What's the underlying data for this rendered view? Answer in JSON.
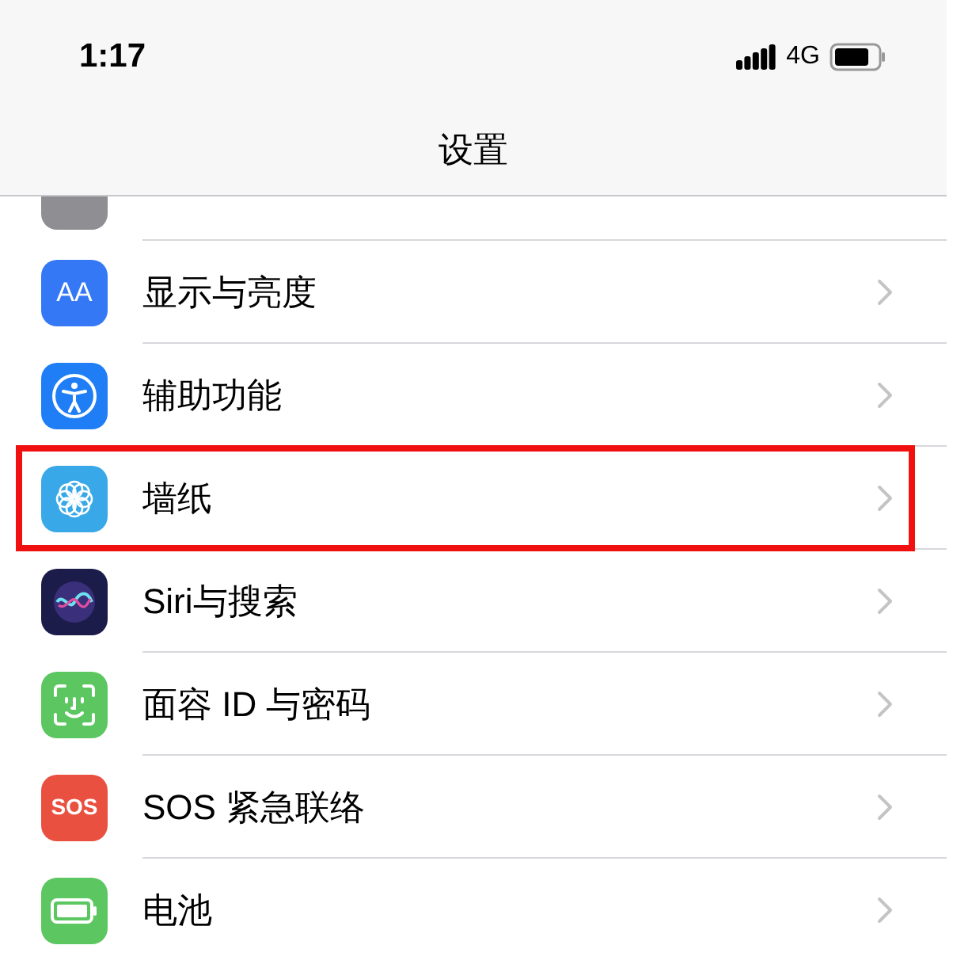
{
  "status_bar": {
    "time": "1:17",
    "network": "4G"
  },
  "nav": {
    "title": "设置"
  },
  "items": [
    {
      "kind": "control",
      "highlighted": false
    },
    {
      "kind": "display",
      "label": "显示与亮度",
      "icon_text": "AA",
      "highlighted": false
    },
    {
      "kind": "accessibility",
      "label": "辅助功能",
      "highlighted": false
    },
    {
      "kind": "wallpaper",
      "label": "墙纸",
      "highlighted": true
    },
    {
      "kind": "siri",
      "label": "Siri与搜索",
      "highlighted": false
    },
    {
      "kind": "faceid",
      "label": "面容 ID 与密码",
      "highlighted": false
    },
    {
      "kind": "sos",
      "label": "SOS 紧急联络",
      "icon_text": "SOS",
      "highlighted": false
    },
    {
      "kind": "battery",
      "label": "电池",
      "highlighted": false
    }
  ]
}
